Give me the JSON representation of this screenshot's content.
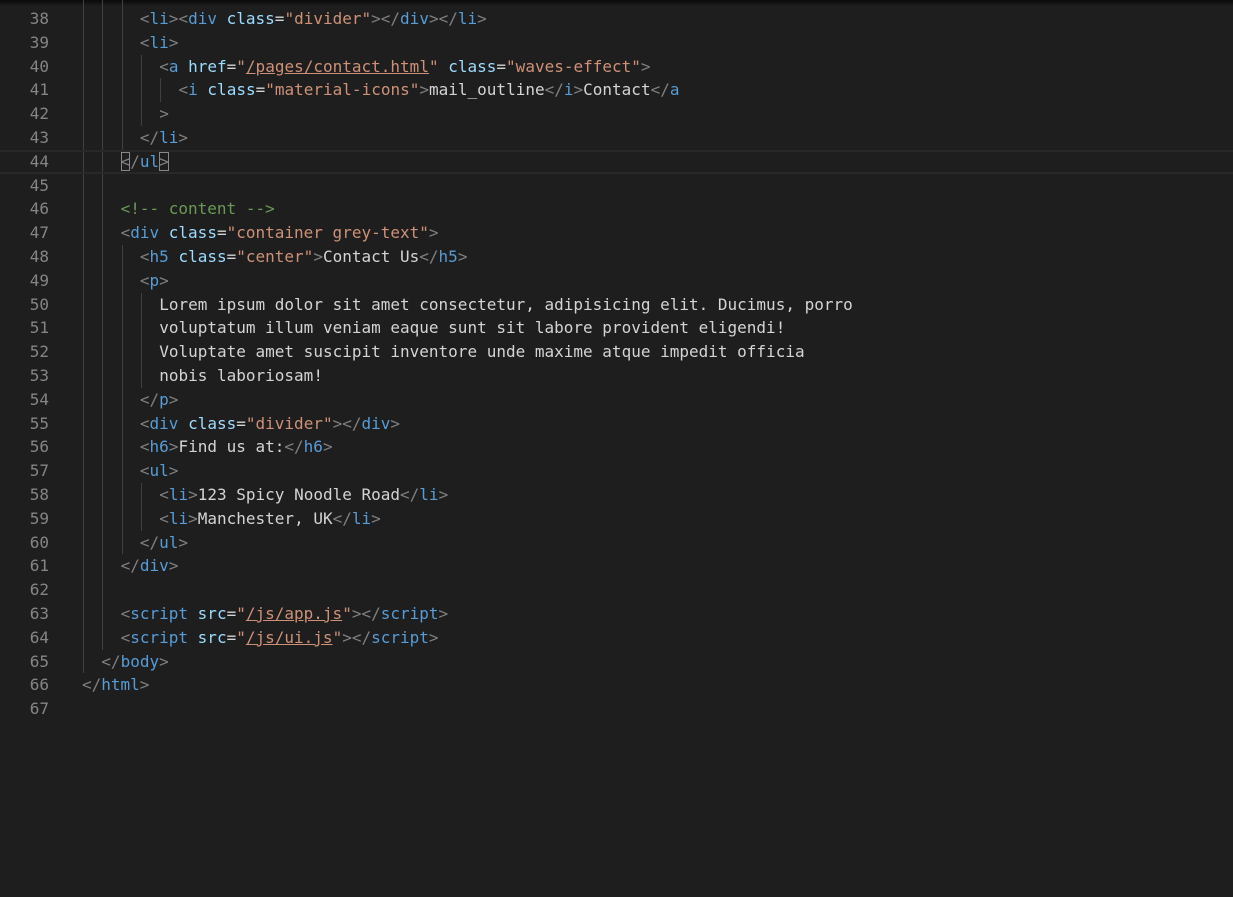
{
  "editor": {
    "lines": [
      {
        "n": "38",
        "indent": 3,
        "tokens": [
          [
            "punc",
            "<"
          ],
          [
            "tag",
            "li"
          ],
          [
            "punc",
            ">"
          ],
          [
            "punc",
            "<"
          ],
          [
            "tag",
            "div"
          ],
          [
            "text",
            " "
          ],
          [
            "attr",
            "class"
          ],
          [
            "text",
            "="
          ],
          [
            "str",
            "\"divider\""
          ],
          [
            "punc",
            ">"
          ],
          [
            "punc",
            "</"
          ],
          [
            "tag",
            "div"
          ],
          [
            "punc",
            ">"
          ],
          [
            "punc",
            "</"
          ],
          [
            "tag",
            "li"
          ],
          [
            "punc",
            ">"
          ]
        ]
      },
      {
        "n": "39",
        "indent": 3,
        "tokens": [
          [
            "punc",
            "<"
          ],
          [
            "tag",
            "li"
          ],
          [
            "punc",
            ">"
          ]
        ]
      },
      {
        "n": "40",
        "indent": 4,
        "tokens": [
          [
            "punc",
            "<"
          ],
          [
            "tag",
            "a"
          ],
          [
            "text",
            " "
          ],
          [
            "attr",
            "href"
          ],
          [
            "text",
            "="
          ],
          [
            "str",
            "\""
          ],
          [
            "strlink",
            "/pages/contact.html"
          ],
          [
            "str",
            "\""
          ],
          [
            "text",
            " "
          ],
          [
            "attr",
            "class"
          ],
          [
            "text",
            "="
          ],
          [
            "str",
            "\"waves-effect\""
          ],
          [
            "punc",
            ">"
          ]
        ]
      },
      {
        "n": "41",
        "indent": 5,
        "tokens": [
          [
            "punc",
            "<"
          ],
          [
            "tag",
            "i"
          ],
          [
            "text",
            " "
          ],
          [
            "attr",
            "class"
          ],
          [
            "text",
            "="
          ],
          [
            "str",
            "\"material-icons\""
          ],
          [
            "punc",
            ">"
          ],
          [
            "text",
            "mail_outline"
          ],
          [
            "punc",
            "</"
          ],
          [
            "tag",
            "i"
          ],
          [
            "punc",
            ">"
          ],
          [
            "text",
            "Contact"
          ],
          [
            "punc",
            "</"
          ],
          [
            "tag",
            "a"
          ]
        ]
      },
      {
        "n": "42",
        "indent": 4,
        "tokens": [
          [
            "punc",
            ">"
          ]
        ]
      },
      {
        "n": "43",
        "indent": 3,
        "tokens": [
          [
            "punc",
            "</"
          ],
          [
            "tag",
            "li"
          ],
          [
            "punc",
            ">"
          ]
        ]
      },
      {
        "n": "44",
        "indent": 2,
        "current": true,
        "tokens": [
          [
            "puncbm",
            "<"
          ],
          [
            "punc",
            "/"
          ],
          [
            "tag",
            "ul"
          ],
          [
            "puncbm",
            ">"
          ]
        ]
      },
      {
        "n": "45",
        "indent": 2,
        "tokens": []
      },
      {
        "n": "46",
        "indent": 2,
        "tokens": [
          [
            "comment",
            "<!-- content -->"
          ]
        ]
      },
      {
        "n": "47",
        "indent": 2,
        "tokens": [
          [
            "punc",
            "<"
          ],
          [
            "tag",
            "div"
          ],
          [
            "text",
            " "
          ],
          [
            "attr",
            "class"
          ],
          [
            "text",
            "="
          ],
          [
            "str",
            "\"container grey-text\""
          ],
          [
            "punc",
            ">"
          ]
        ]
      },
      {
        "n": "48",
        "indent": 3,
        "tokens": [
          [
            "punc",
            "<"
          ],
          [
            "tag",
            "h5"
          ],
          [
            "text",
            " "
          ],
          [
            "attr",
            "class"
          ],
          [
            "text",
            "="
          ],
          [
            "str",
            "\"center\""
          ],
          [
            "punc",
            ">"
          ],
          [
            "text",
            "Contact Us"
          ],
          [
            "punc",
            "</"
          ],
          [
            "tag",
            "h5"
          ],
          [
            "punc",
            ">"
          ]
        ]
      },
      {
        "n": "49",
        "indent": 3,
        "tokens": [
          [
            "punc",
            "<"
          ],
          [
            "tag",
            "p"
          ],
          [
            "punc",
            ">"
          ]
        ]
      },
      {
        "n": "50",
        "indent": 4,
        "tokens": [
          [
            "text",
            "Lorem ipsum dolor sit amet consectetur, adipisicing elit. Ducimus, porro"
          ]
        ]
      },
      {
        "n": "51",
        "indent": 4,
        "tokens": [
          [
            "text",
            "voluptatum illum veniam eaque sunt sit labore provident eligendi!"
          ]
        ]
      },
      {
        "n": "52",
        "indent": 4,
        "tokens": [
          [
            "text",
            "Voluptate amet suscipit inventore unde maxime atque impedit officia"
          ]
        ]
      },
      {
        "n": "53",
        "indent": 4,
        "tokens": [
          [
            "text",
            "nobis laboriosam!"
          ]
        ]
      },
      {
        "n": "54",
        "indent": 3,
        "tokens": [
          [
            "punc",
            "</"
          ],
          [
            "tag",
            "p"
          ],
          [
            "punc",
            ">"
          ]
        ]
      },
      {
        "n": "55",
        "indent": 3,
        "tokens": [
          [
            "punc",
            "<"
          ],
          [
            "tag",
            "div"
          ],
          [
            "text",
            " "
          ],
          [
            "attr",
            "class"
          ],
          [
            "text",
            "="
          ],
          [
            "str",
            "\"divider\""
          ],
          [
            "punc",
            ">"
          ],
          [
            "punc",
            "</"
          ],
          [
            "tag",
            "div"
          ],
          [
            "punc",
            ">"
          ]
        ]
      },
      {
        "n": "56",
        "indent": 3,
        "tokens": [
          [
            "punc",
            "<"
          ],
          [
            "tag",
            "h6"
          ],
          [
            "punc",
            ">"
          ],
          [
            "text",
            "Find us at:"
          ],
          [
            "punc",
            "</"
          ],
          [
            "tag",
            "h6"
          ],
          [
            "punc",
            ">"
          ]
        ]
      },
      {
        "n": "57",
        "indent": 3,
        "tokens": [
          [
            "punc",
            "<"
          ],
          [
            "tag",
            "ul"
          ],
          [
            "punc",
            ">"
          ]
        ]
      },
      {
        "n": "58",
        "indent": 4,
        "tokens": [
          [
            "punc",
            "<"
          ],
          [
            "tag",
            "li"
          ],
          [
            "punc",
            ">"
          ],
          [
            "text",
            "123 Spicy Noodle Road"
          ],
          [
            "punc",
            "</"
          ],
          [
            "tag",
            "li"
          ],
          [
            "punc",
            ">"
          ]
        ]
      },
      {
        "n": "59",
        "indent": 4,
        "tokens": [
          [
            "punc",
            "<"
          ],
          [
            "tag",
            "li"
          ],
          [
            "punc",
            ">"
          ],
          [
            "text",
            "Manchester, UK"
          ],
          [
            "punc",
            "</"
          ],
          [
            "tag",
            "li"
          ],
          [
            "punc",
            ">"
          ]
        ]
      },
      {
        "n": "60",
        "indent": 3,
        "tokens": [
          [
            "punc",
            "</"
          ],
          [
            "tag",
            "ul"
          ],
          [
            "punc",
            ">"
          ]
        ]
      },
      {
        "n": "61",
        "indent": 2,
        "tokens": [
          [
            "punc",
            "</"
          ],
          [
            "tag",
            "div"
          ],
          [
            "punc",
            ">"
          ]
        ]
      },
      {
        "n": "62",
        "indent": 2,
        "tokens": []
      },
      {
        "n": "63",
        "indent": 2,
        "tokens": [
          [
            "punc",
            "<"
          ],
          [
            "tag",
            "script"
          ],
          [
            "text",
            " "
          ],
          [
            "attr",
            "src"
          ],
          [
            "text",
            "="
          ],
          [
            "str",
            "\""
          ],
          [
            "strlink",
            "/js/app.js"
          ],
          [
            "str",
            "\""
          ],
          [
            "punc",
            ">"
          ],
          [
            "punc",
            "</"
          ],
          [
            "tag",
            "script"
          ],
          [
            "punc",
            ">"
          ]
        ]
      },
      {
        "n": "64",
        "indent": 2,
        "tokens": [
          [
            "punc",
            "<"
          ],
          [
            "tag",
            "script"
          ],
          [
            "text",
            " "
          ],
          [
            "attr",
            "src"
          ],
          [
            "text",
            "="
          ],
          [
            "str",
            "\""
          ],
          [
            "strlink",
            "/js/ui.js"
          ],
          [
            "str",
            "\""
          ],
          [
            "punc",
            ">"
          ],
          [
            "punc",
            "</"
          ],
          [
            "tag",
            "script"
          ],
          [
            "punc",
            ">"
          ]
        ]
      },
      {
        "n": "65",
        "indent": 1,
        "tokens": [
          [
            "punc",
            "</"
          ],
          [
            "tag",
            "body"
          ],
          [
            "punc",
            ">"
          ]
        ]
      },
      {
        "n": "66",
        "indent": 0,
        "tokens": [
          [
            "punc",
            "</"
          ],
          [
            "tag",
            "html"
          ],
          [
            "punc",
            ">"
          ]
        ]
      },
      {
        "n": "67",
        "indent": 0,
        "tokens": []
      }
    ]
  }
}
